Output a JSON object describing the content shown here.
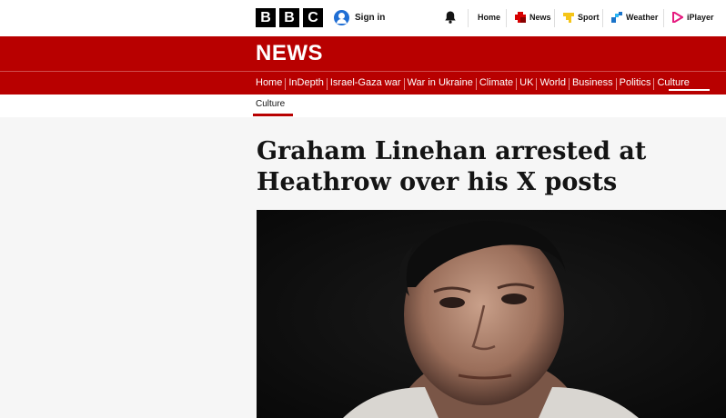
{
  "brand": {
    "letters": [
      "B",
      "B",
      "C"
    ]
  },
  "topnav": {
    "signin_label": "Sign in",
    "items": [
      {
        "label": "Home",
        "icon": "home-icon"
      },
      {
        "label": "News",
        "icon": "news-icon",
        "color": "#d70000"
      },
      {
        "label": "Sport",
        "icon": "sport-icon",
        "color": "#f5c518"
      },
      {
        "label": "Weather",
        "icon": "weather-icon",
        "color": "#1a73c9"
      },
      {
        "label": "iPlayer",
        "icon": "iplayer-icon",
        "color": "#e5197e"
      }
    ]
  },
  "news_banner": {
    "title": "NEWS"
  },
  "section_nav": {
    "items": [
      "Home",
      "InDepth",
      "Israel-Gaza war",
      "War in Ukraine",
      "Climate",
      "UK",
      "World",
      "Business",
      "Politics",
      "Culture"
    ],
    "active": "Culture"
  },
  "subnav": {
    "item": "Culture"
  },
  "article": {
    "headline": "Graham Linehan arrested at Heathrow over his X posts",
    "hero_image": "portrait-photo"
  },
  "colors": {
    "brand_red": "#b80000",
    "signin_blue": "#1f6ed4"
  }
}
